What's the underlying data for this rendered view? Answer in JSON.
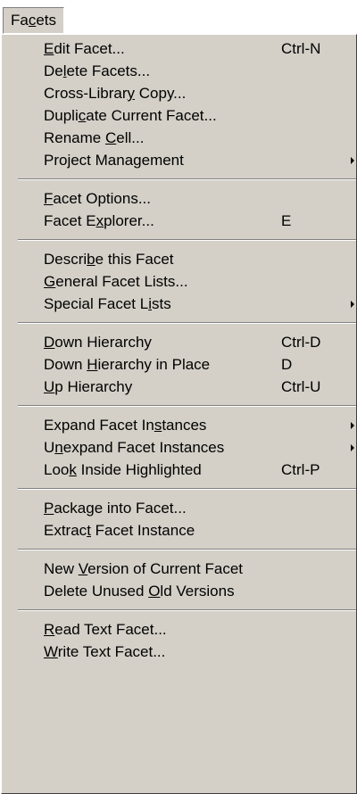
{
  "menubar": {
    "title_pre": "Fa",
    "title_mn": "c",
    "title_post": "ets"
  },
  "menu": [
    {
      "pre": "",
      "mn": "E",
      "post": "dit Facet...",
      "shortcut": "Ctrl-N"
    },
    {
      "pre": "De",
      "mn": "l",
      "post": "ete Facets..."
    },
    {
      "pre": "Cross-Librar",
      "mn": "y",
      "post": " Copy..."
    },
    {
      "pre": "Dupli",
      "mn": "c",
      "post": "ate Current Facet..."
    },
    {
      "pre": "Rename ",
      "mn": "C",
      "post": "ell..."
    },
    {
      "pre": "Project Management",
      "mn": "",
      "post": "",
      "submenu": true
    },
    {
      "sep": true
    },
    {
      "pre": "",
      "mn": "F",
      "post": "acet Options..."
    },
    {
      "pre": "Facet E",
      "mn": "x",
      "post": "plorer...",
      "shortcut": "E"
    },
    {
      "sep": true
    },
    {
      "pre": "Descri",
      "mn": "b",
      "post": "e this Facet"
    },
    {
      "pre": "",
      "mn": "G",
      "post": "eneral Facet Lists..."
    },
    {
      "pre": "Special Facet L",
      "mn": "i",
      "post": "sts",
      "submenu": true
    },
    {
      "sep": true
    },
    {
      "pre": "",
      "mn": "D",
      "post": "own Hierarchy",
      "shortcut": "Ctrl-D"
    },
    {
      "pre": "Down ",
      "mn": "H",
      "post": "ierarchy in Place",
      "shortcut": "D"
    },
    {
      "pre": "",
      "mn": "U",
      "post": "p Hierarchy",
      "shortcut": "Ctrl-U"
    },
    {
      "sep": true
    },
    {
      "pre": "Expand Facet In",
      "mn": "s",
      "post": "tances",
      "submenu": true
    },
    {
      "pre": "U",
      "mn": "n",
      "post": "expand Facet Instances",
      "submenu": true
    },
    {
      "pre": "Loo",
      "mn": "k",
      "post": " Inside Highlighted",
      "shortcut": "Ctrl-P"
    },
    {
      "sep": true
    },
    {
      "pre": "",
      "mn": "P",
      "post": "ackage into Facet..."
    },
    {
      "pre": "Extrac",
      "mn": "t",
      "post": " Facet Instance"
    },
    {
      "sep": true
    },
    {
      "pre": "New ",
      "mn": "V",
      "post": "ersion of Current Facet"
    },
    {
      "pre": "Delete Unused ",
      "mn": "O",
      "post": "ld Versions"
    },
    {
      "sep": true
    },
    {
      "pre": "",
      "mn": "R",
      "post": "ead Text Facet..."
    },
    {
      "pre": "",
      "mn": "W",
      "post": "rite Text Facet..."
    }
  ]
}
